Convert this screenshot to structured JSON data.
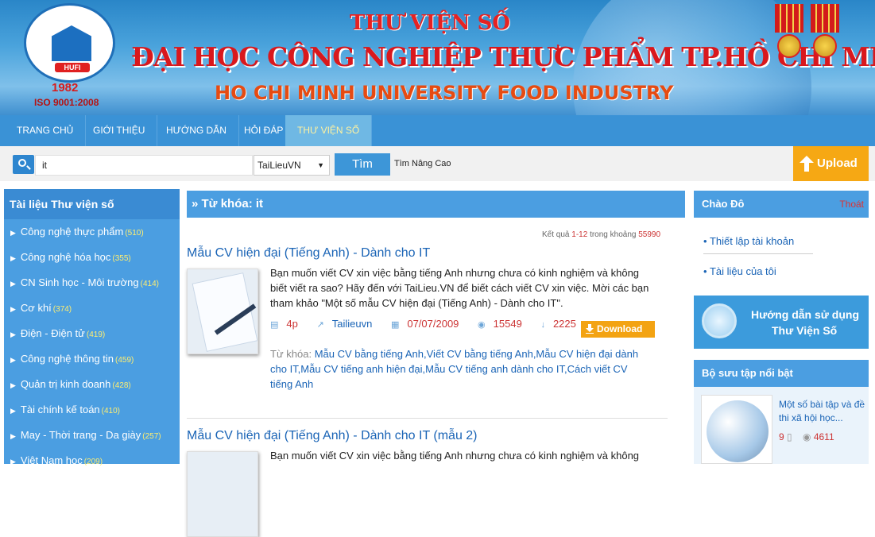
{
  "banner": {
    "title_top": "THƯ VIỆN SỐ",
    "title_main": "ĐẠI HỌC CÔNG NGHIỆP THỰC PHẨM TP.HỒ CHÍ MINH",
    "title_en": "HO CHI MINH UNIVERSITY FOOD INDUSTRY",
    "logo_text": "HUFI",
    "year": "1982",
    "iso": "ISO 9001:2008"
  },
  "nav": {
    "items": [
      "TRANG CHỦ",
      "GIỚI THIỆU",
      "HƯỚNG DẪN",
      "HỎI ĐÁP",
      "THƯ VIỆN SỐ"
    ],
    "active_index": 4
  },
  "search": {
    "value": "it",
    "source_selected": "TaiLieuVN",
    "button_label": "Tìm",
    "advanced_label": "Tìm Nâng Cao",
    "upload_label": "Upload"
  },
  "sidebar": {
    "title": "Tài liệu Thư viện số",
    "categories": [
      {
        "label": "Công nghệ thực phẩm",
        "count": "(510)"
      },
      {
        "label": "Công nghệ hóa học",
        "count": "(355)"
      },
      {
        "label": "CN Sinh học - Môi trường",
        "count": "(414)"
      },
      {
        "label": "Cơ khí",
        "count": "(374)"
      },
      {
        "label": "Điện - Điện tử",
        "count": "(419)"
      },
      {
        "label": "Công nghệ thông tin",
        "count": "(459)"
      },
      {
        "label": "Quản trị kinh doanh",
        "count": "(428)"
      },
      {
        "label": "Tài chính kế toán",
        "count": "(410)"
      },
      {
        "label": "May - Thời trang - Da giày",
        "count": "(257)"
      },
      {
        "label": "Việt Nam học",
        "count": "(209)"
      }
    ]
  },
  "main": {
    "heading": "» Từ khóa: it",
    "result_prefix": "Kết quả",
    "result_range": "1-12",
    "result_mid": "trong khoảng",
    "result_total": "55990",
    "docs": [
      {
        "title": "Mẫu CV hiện đại (Tiếng Anh) - Dành cho IT",
        "desc": "Bạn muốn viết CV xin việc bằng tiếng Anh nhưng chưa có kinh nghiệm và không biết viết ra sao? Hãy đến với TaiLieu.VN để biết cách viết CV xin việc. Mời các bạn tham khảo \"Một số mẫu CV hiện đại (Tiếng Anh) - Dành cho IT\".",
        "pages": "4p",
        "author": "Tailieuvn",
        "date": "07/07/2009",
        "views": "15549",
        "downloads": "2225",
        "download_label": "Download",
        "keywords_label": "Từ khóa:",
        "keywords": "Mẫu CV bằng tiếng Anh,Viết CV bằng tiếng Anh,Mẫu CV hiện đại dành cho IT,Mẫu CV tiếng anh hiện đại,Mẫu CV tiếng anh dành cho IT,Cách viết CV tiếng Anh"
      },
      {
        "title": "Mẫu CV hiện đại (Tiếng Anh) - Dành cho IT (mẫu 2)",
        "desc": "Bạn muốn viết CV xin việc bằng tiếng Anh nhưng chưa có kinh nghiệm và không"
      }
    ]
  },
  "right": {
    "greeting": "Chào Đô",
    "logout": "Thoát",
    "links": [
      "Thiết lập tài khoản",
      "Tài liệu của tôi"
    ],
    "guide_line1": "Hướng dẫn sử dụng",
    "guide_line2": "Thư Viện Số",
    "collection_title": "Bộ sưu tập nổi bật",
    "collection_item": {
      "title": "Một số bài tập và đề thi xã hội học...",
      "pages": "9",
      "views": "4611"
    }
  },
  "colors": {
    "nav_blue": "#3a92d6",
    "panel_blue": "#4b9ee1",
    "accent_orange": "#f6a814",
    "link_blue": "#1a64b6",
    "count_red": "#cc3333"
  },
  "icons": {
    "search": "magnifier-icon",
    "upload": "upload-arrow-icon",
    "download": "download-arrow-icon",
    "doc_type": "doc-icon"
  }
}
